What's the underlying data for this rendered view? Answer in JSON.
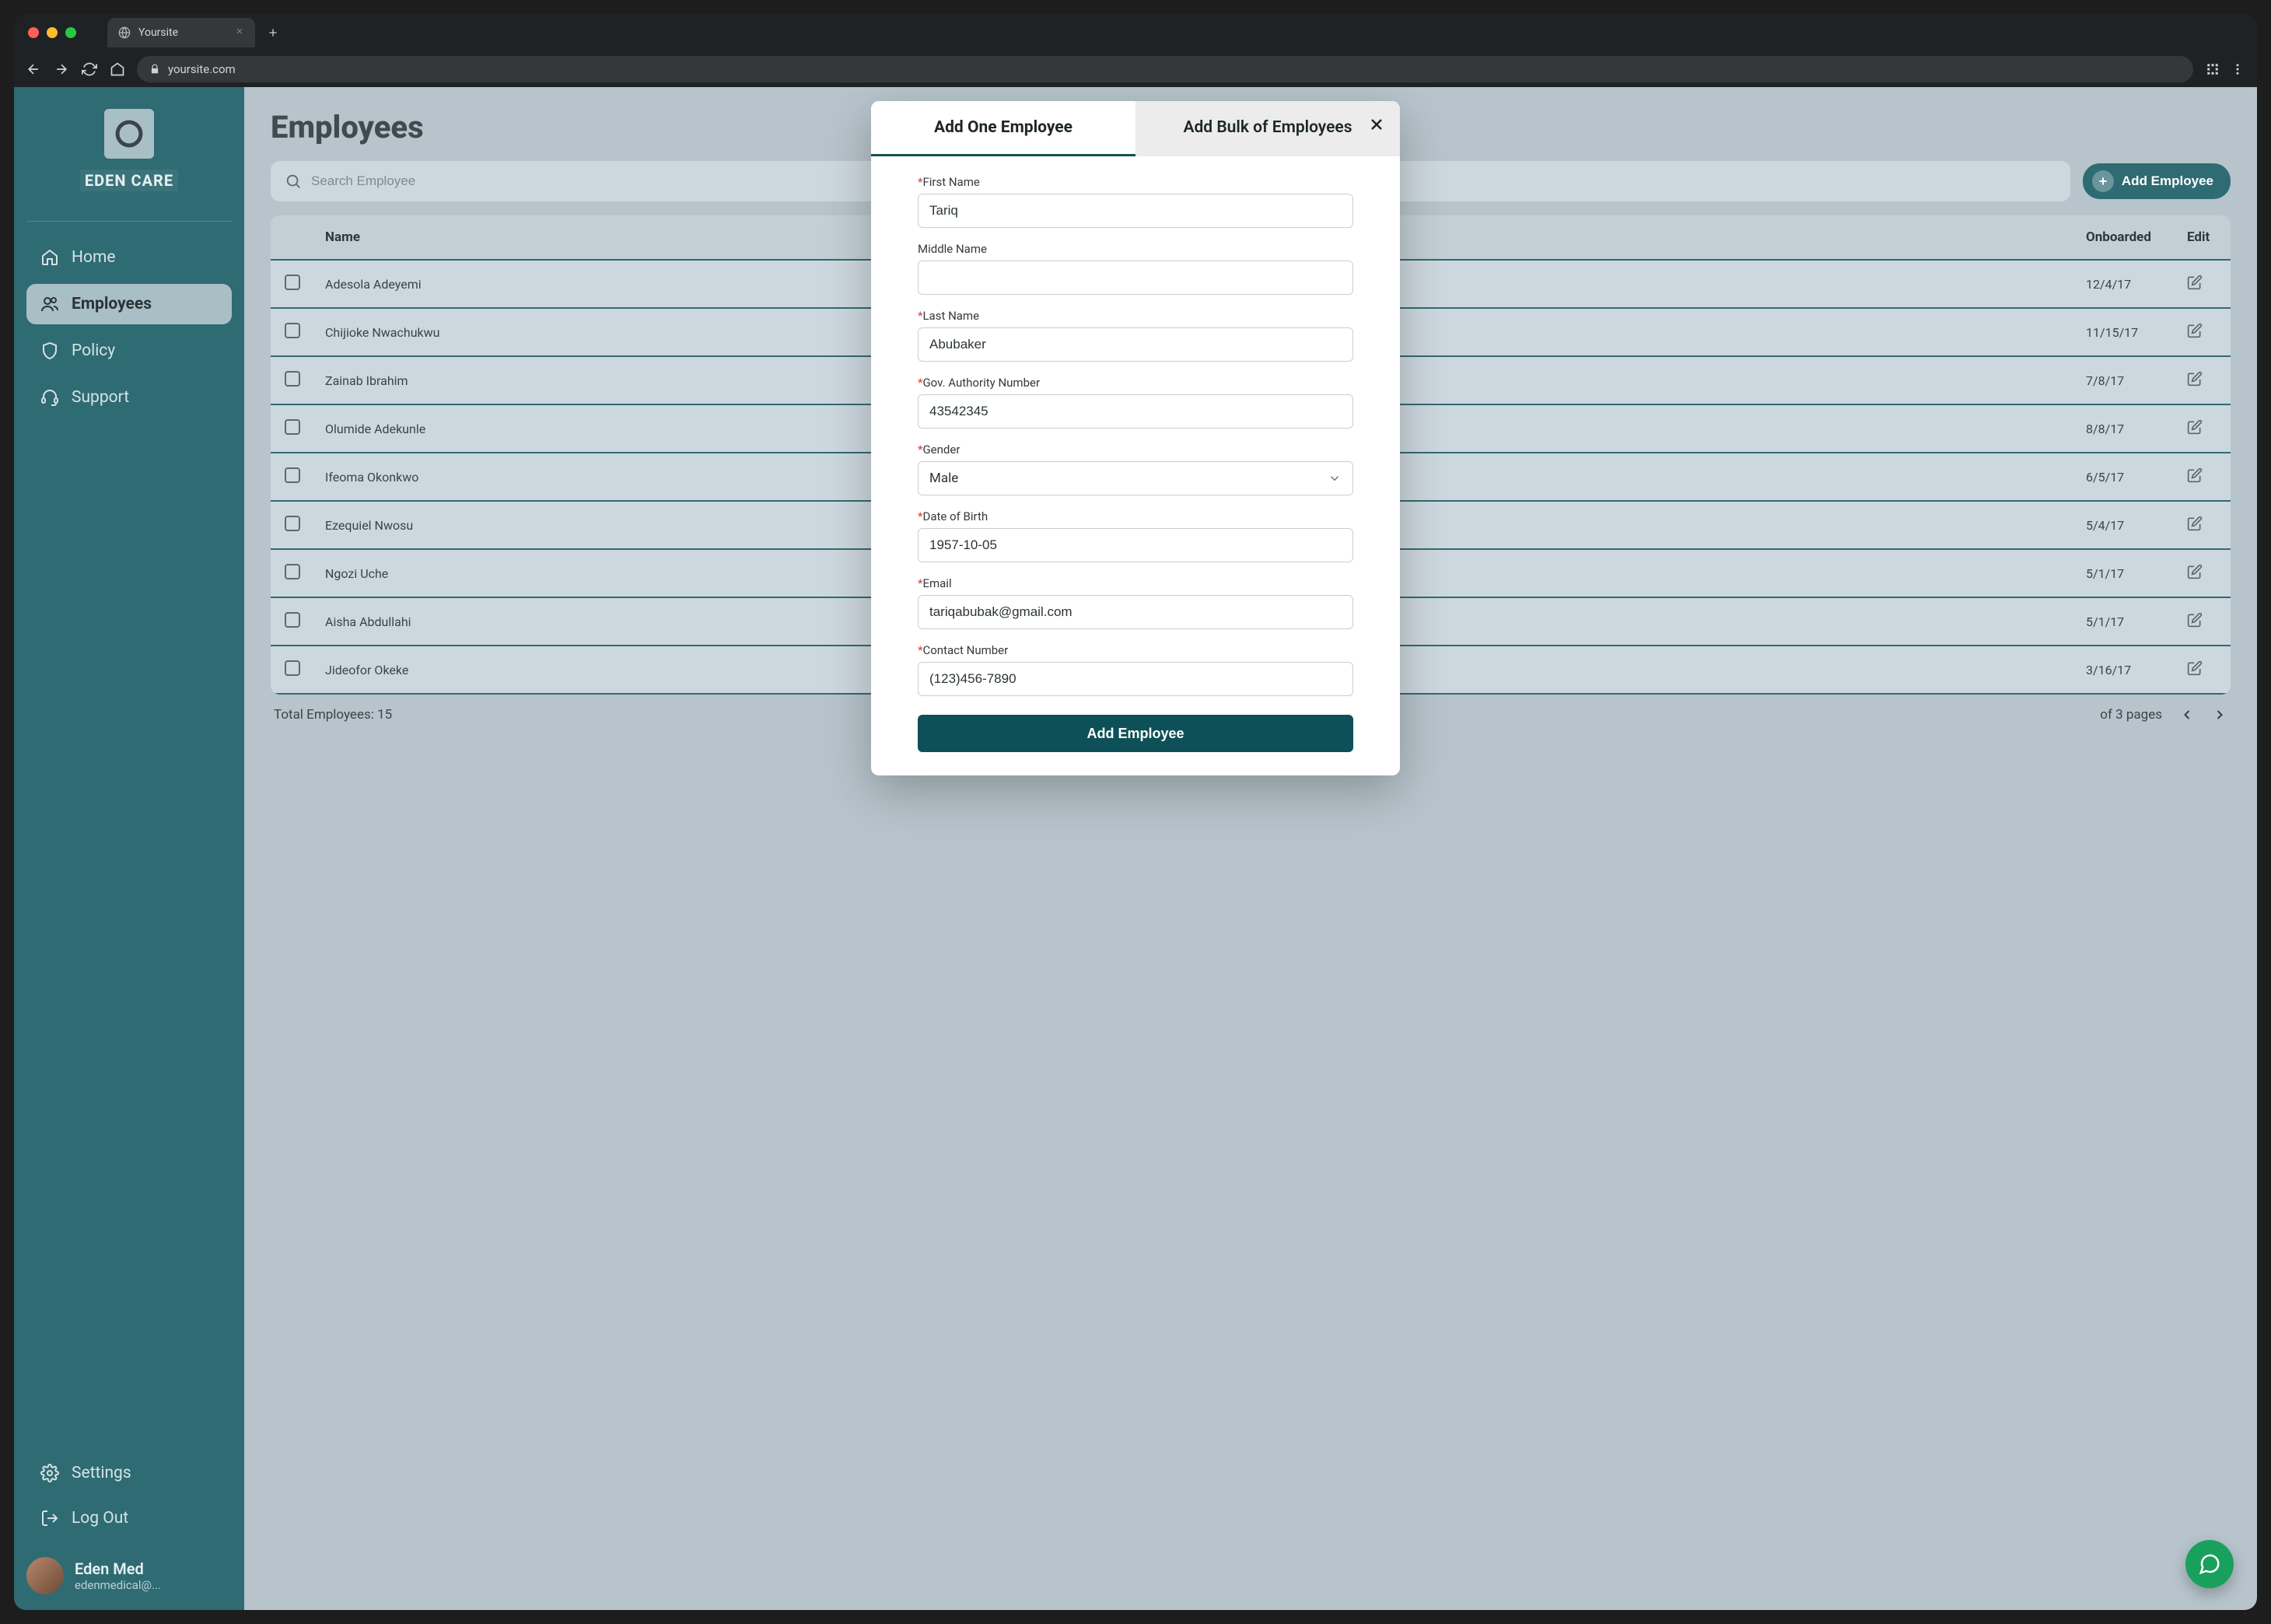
{
  "browser": {
    "tab_title": "Yoursite",
    "url": "yoursite.com"
  },
  "brand": {
    "name": "EDEN CARE"
  },
  "nav": {
    "home": "Home",
    "employees": "Employees",
    "policy": "Policy",
    "support": "Support",
    "settings": "Settings",
    "logout": "Log Out"
  },
  "user": {
    "name": "Eden Med",
    "email": "edenmedical@..."
  },
  "page": {
    "title": "Employees",
    "search_placeholder": "Search Employee",
    "add_button": "Add Employee"
  },
  "table": {
    "headers": {
      "name": "Name",
      "onboarded": "Onboarded",
      "edit": "Edit"
    },
    "rows": [
      {
        "name": "Adesola Adeyemi",
        "onboarded": "12/4/17"
      },
      {
        "name": "Chijioke Nwachukwu",
        "onboarded": "11/15/17"
      },
      {
        "name": "Zainab Ibrahim",
        "onboarded": "7/8/17"
      },
      {
        "name": "Olumide Adekunle",
        "onboarded": "8/8/17"
      },
      {
        "name": "Ifeoma Okonkwo",
        "onboarded": "6/5/17"
      },
      {
        "name": "Ezequiel Nwosu",
        "onboarded": "5/4/17"
      },
      {
        "name": "Ngozi Uche",
        "onboarded": "5/1/17"
      },
      {
        "name": "Aisha Abdullahi",
        "onboarded": "5/1/17"
      },
      {
        "name": "Jideofor Okeke",
        "onboarded": "3/16/17"
      }
    ]
  },
  "footer": {
    "total": "Total Employees: 15",
    "page_info": "of 3 pages"
  },
  "modal": {
    "tab_one": "Add One Employee",
    "tab_bulk": "Add Bulk of Employees",
    "labels": {
      "first_name": "First Name",
      "middle_name": "Middle Name",
      "last_name": "Last Name",
      "gov_auth": "Gov. Authority Number",
      "gender": "Gender",
      "dob": "Date of Birth",
      "email": "Email",
      "contact": "Contact Number"
    },
    "values": {
      "first_name": "Tariq",
      "middle_name": "",
      "last_name": "Abubaker",
      "gov_auth": "43542345",
      "gender": "Male",
      "dob": "1957-10-05",
      "email": "tariqabubak@gmail.com",
      "contact": "(123)456-7890"
    },
    "submit": "Add Employee"
  }
}
